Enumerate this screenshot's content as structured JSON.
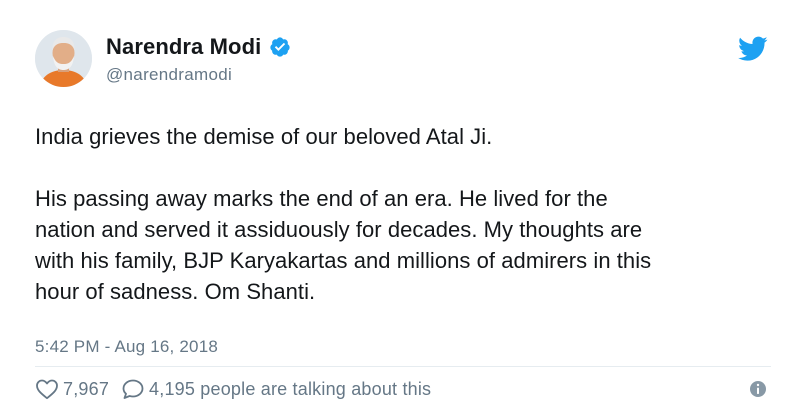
{
  "tweet": {
    "author": {
      "display_name": "Narendra Modi",
      "handle": "@narendramodi",
      "avatar_icon": "profile-photo",
      "verified": true
    },
    "text": [
      "India grieves the demise of our beloved Atal Ji.",
      "His passing away marks the end of an era. He lived for the",
      "nation and served it assiduously for decades. My thoughts are",
      "with his family, BJP Karyakartas and millions of admirers in this",
      "hour of sadness. Om Shanti."
    ],
    "timestamp": "5:42 PM - Aug 16, 2018",
    "likes": "7,967",
    "conversation": "4,195 people are talking about this"
  },
  "colors": {
    "text": "#14171a",
    "secondary": "#657786",
    "twitter_blue": "#1da1f2",
    "divider": "#e6ecf0"
  }
}
